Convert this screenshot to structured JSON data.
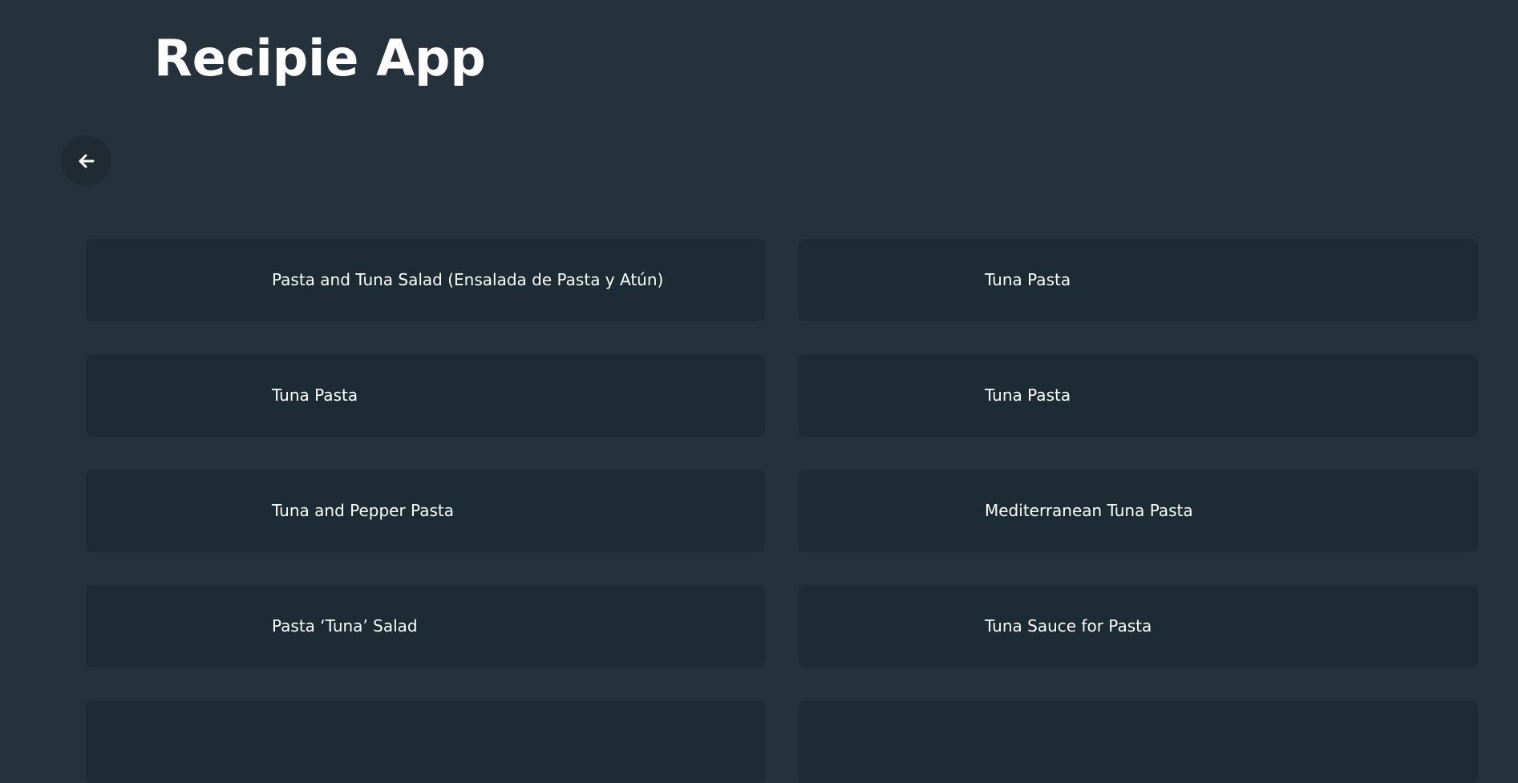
{
  "app": {
    "title": "Recipie App"
  },
  "nav": {
    "back_icon": "arrow-left-icon"
  },
  "recipes": [
    {
      "name": "Pasta and Tuna Salad (Ensalada de Pasta y Atún)"
    },
    {
      "name": "Tuna Pasta"
    },
    {
      "name": "Tuna Pasta"
    },
    {
      "name": "Tuna Pasta"
    },
    {
      "name": "Tuna and Pepper Pasta"
    },
    {
      "name": "Mediterranean Tuna Pasta"
    },
    {
      "name": "Pasta ‘Tuna’ Salad"
    },
    {
      "name": "Tuna Sauce for Pasta"
    },
    {
      "name": ""
    },
    {
      "name": ""
    }
  ],
  "colors": {
    "background": "#25313b",
    "card": "#1d2b34",
    "back_button": "#1f2a33",
    "text": "#ffffff"
  }
}
